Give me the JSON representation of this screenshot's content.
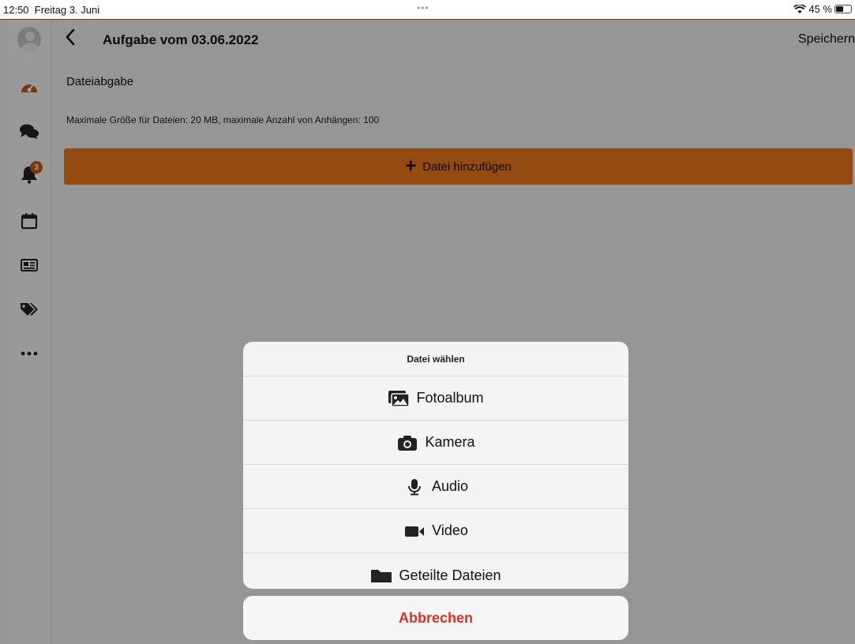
{
  "status_bar": {
    "time": "12:50",
    "date": "Freitag 3. Juni",
    "dots": "•••",
    "battery_text": "45 %"
  },
  "header": {
    "back_icon": "chevron-left-icon",
    "title": "Aufgabe vom 03.06.2022",
    "save_label": "Speichern"
  },
  "sidebar": {
    "items": [
      {
        "icon": "avatar-icon"
      },
      {
        "icon": "dashboard-icon"
      },
      {
        "icon": "chat-icon"
      },
      {
        "icon": "bell-icon",
        "badge": "3"
      },
      {
        "icon": "calendar-icon"
      },
      {
        "icon": "news-icon"
      },
      {
        "icon": "tags-icon"
      },
      {
        "icon": "more-icon"
      }
    ]
  },
  "main": {
    "section_title": "Dateiabgabe",
    "info": "Maximale Größe für Dateien: 20 MB, maximale Anzahl von Anhängen: 100",
    "add_file_label": "Datei hinzufügen"
  },
  "action_sheet": {
    "title": "Datei wählen",
    "items": [
      {
        "label": "Fotoalbum",
        "icon": "photo-album-icon"
      },
      {
        "label": "Kamera",
        "icon": "camera-icon"
      },
      {
        "label": "Audio",
        "icon": "microphone-icon"
      },
      {
        "label": "Video",
        "icon": "video-icon"
      },
      {
        "label": "Geteilte Dateien",
        "icon": "folder-icon"
      }
    ],
    "cancel_label": "Abbrechen"
  },
  "colors": {
    "accent": "#f07a1a",
    "cancel": "#d6341f",
    "frame_line": "#c55a11"
  }
}
